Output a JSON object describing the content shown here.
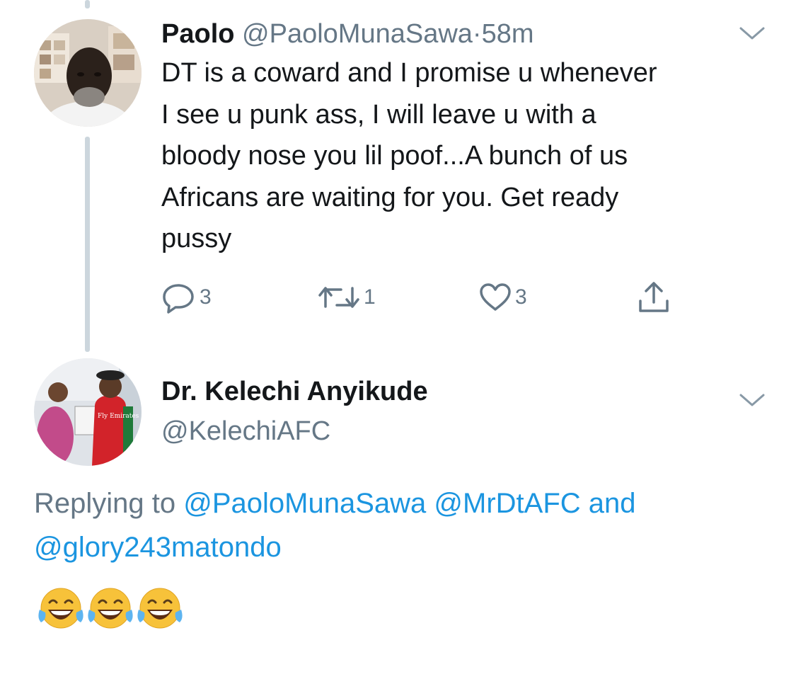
{
  "tweet": {
    "author_name": "Paolo",
    "author_handle": "@PaoloMunaSawa",
    "separator": "·",
    "time": "58m",
    "text_lines": [
      "DT is a coward and I promise u whenever",
      "I see u punk ass, I will leave u with a",
      "bloody nose you lil poof...A bunch of us",
      "Africans are waiting for you. Get ready",
      "pussy"
    ],
    "actions": {
      "reply_count": "3",
      "retweet_count": "1",
      "like_count": "3"
    }
  },
  "reply": {
    "author_name": "Dr. Kelechi Anyikude",
    "author_handle": "@KelechiAFC",
    "replying_to_label": "Replying to",
    "mentions": [
      "@PaoloMunaSawa",
      "@MrDtAFC",
      "@glory243matondo"
    ],
    "conjunction": "and",
    "avatar_shirt_text": "Fly Emirates",
    "emojis": [
      "face-with-tears-of-joy",
      "face-with-tears-of-joy",
      "face-with-tears-of-joy"
    ]
  },
  "colors": {
    "text": "#14171a",
    "secondary": "#657786",
    "link": "#1b95e0",
    "thread_line": "#ccd6dd"
  }
}
